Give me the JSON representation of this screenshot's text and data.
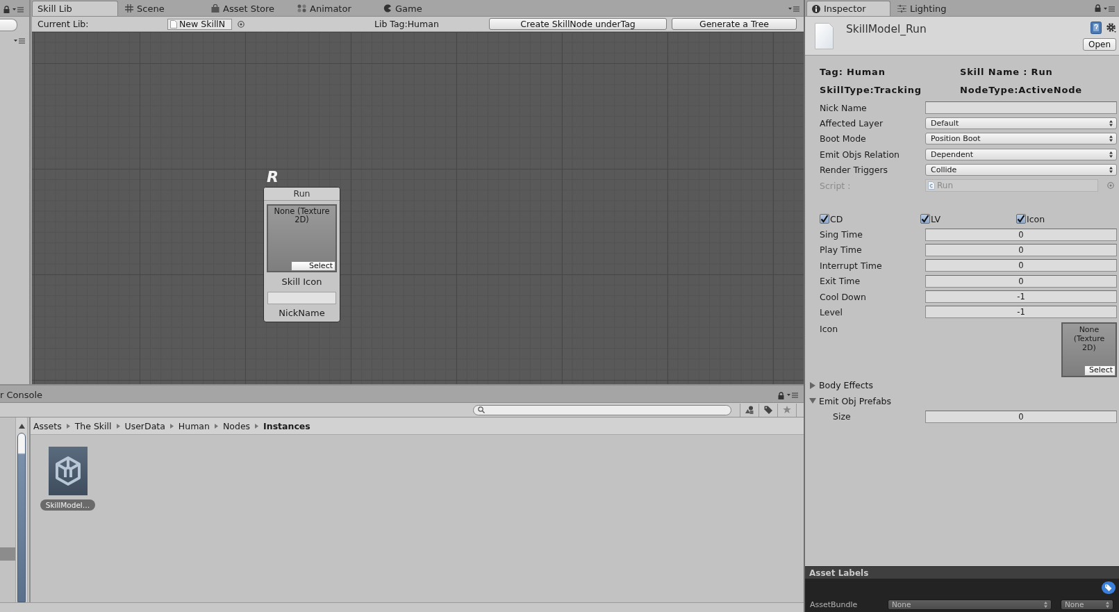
{
  "skill_lib": {
    "tabs": [
      {
        "label": "Skill Lib",
        "selected": true
      },
      {
        "label": "Scene",
        "selected": false
      },
      {
        "label": "Asset Store",
        "selected": false
      },
      {
        "label": "Animator",
        "selected": false
      },
      {
        "label": "Game",
        "selected": false
      }
    ],
    "toolbar": {
      "current_lib_label": "Current Lib:",
      "lib_field_value": "New SkillN",
      "lib_tag": "Lib Tag:Human",
      "buttons": [
        "Create SkillNode underTag",
        "Generate a Tree"
      ]
    },
    "nodes": [
      {
        "badge": "R",
        "title": "Run",
        "texture_text": "None (Texture 2D)",
        "select_button": "Select",
        "icon_label": "Skill Icon",
        "nickname_label": "NickName"
      }
    ]
  },
  "project": {
    "tab_label": "r Console",
    "breadcrumb": [
      {
        "label": "Assets",
        "current": false
      },
      {
        "label": "The Skill",
        "current": false
      },
      {
        "label": "UserData",
        "current": false
      },
      {
        "label": "Human",
        "current": false
      },
      {
        "label": "Nodes",
        "current": false
      },
      {
        "label": "Instances",
        "current": true
      }
    ],
    "assets": [
      {
        "name": "SkillModel…",
        "selected": true
      }
    ]
  },
  "inspector": {
    "tabs": [
      {
        "label": "Inspector",
        "selected": true
      },
      {
        "label": "Lighting",
        "selected": false
      }
    ],
    "asset_name": "SkillModel_Run",
    "open_button": "Open",
    "summary_rows": [
      {
        "left": "Tag: Human",
        "right": "Skill Name : Run"
      },
      {
        "left": "SkillType:Tracking",
        "right": "NodeType:ActiveNode"
      }
    ],
    "fields": [
      {
        "kind": "text",
        "label": "Nick Name",
        "disabled": false
      },
      {
        "kind": "dropdown",
        "label": "Affected Layer",
        "value": "Default",
        "disabled": false
      },
      {
        "kind": "dropdown",
        "label": "Boot Mode",
        "value": "Position Boot",
        "disabled": false
      },
      {
        "kind": "dropdown",
        "label": "Emit Objs Relation",
        "value": "Dependent",
        "disabled": false
      },
      {
        "kind": "dropdown",
        "label": "Render Triggers",
        "value": "Collide",
        "disabled": false
      },
      {
        "kind": "object",
        "label": "Script :",
        "value": "Run",
        "disabled": true
      }
    ],
    "toggles": [
      {
        "label": "CD",
        "checked": true
      },
      {
        "label": "LV",
        "checked": true
      },
      {
        "label": "Icon",
        "checked": true
      }
    ],
    "number_fields": [
      {
        "label": "Sing Time",
        "value": "0"
      },
      {
        "label": "Play Time",
        "value": "0"
      },
      {
        "label": "Interrupt Time",
        "value": "0"
      },
      {
        "label": "Exit Time",
        "value": "0"
      },
      {
        "label": "Cool Down",
        "value": "-1"
      },
      {
        "label": "Level",
        "value": "-1"
      }
    ],
    "icon_field": {
      "label": "Icon",
      "texture_text": "None (Texture 2D)",
      "select_button": "Select"
    },
    "foldouts": [
      {
        "label": "Body Effects",
        "expanded": false
      },
      {
        "label": "Emit Obj Prefabs",
        "expanded": true,
        "children": [
          {
            "label": "Size",
            "value": "0"
          }
        ]
      }
    ],
    "asset_labels": {
      "title": "Asset Labels",
      "asset_bundle_label": "AssetBundle",
      "dropdowns": [
        "None",
        "None"
      ]
    }
  }
}
